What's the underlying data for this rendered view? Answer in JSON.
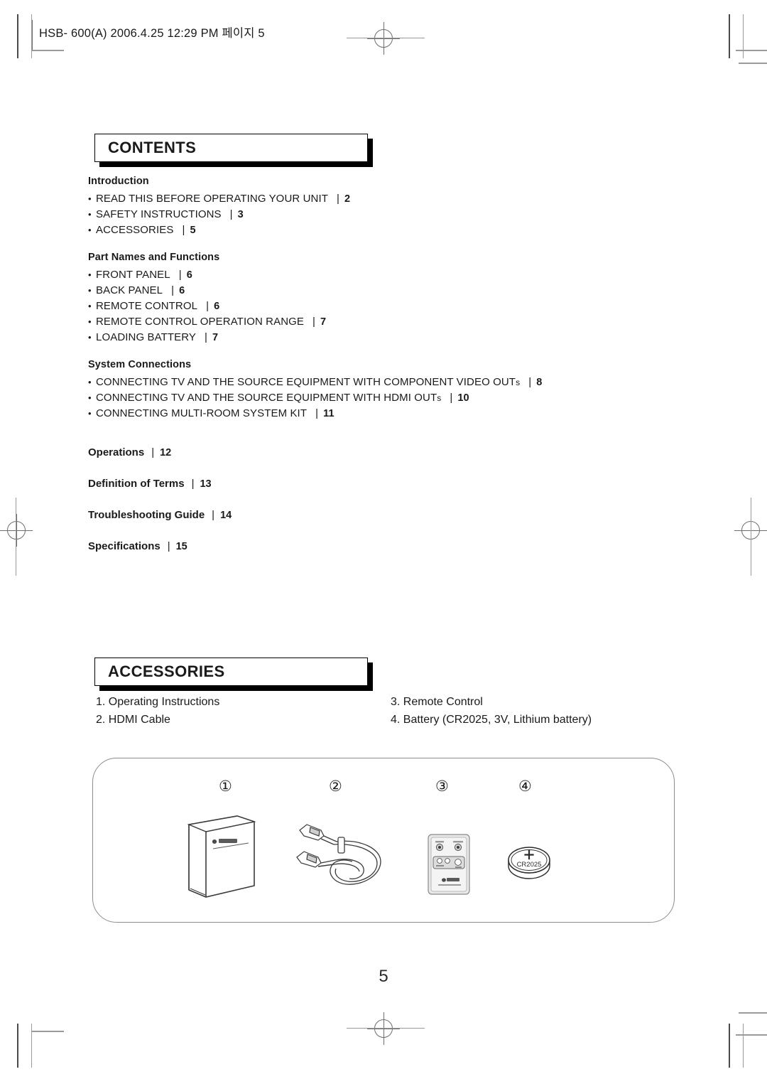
{
  "header": {
    "slug": "HSB- 600(A)  2006.4.25  12:29 PM  페이지 5"
  },
  "contents": {
    "heading": "CONTENTS",
    "groups": [
      {
        "title": "Introduction",
        "items": [
          {
            "label": "READ THIS BEFORE OPERATING YOUR UNIT",
            "suffix": "",
            "separator": "|",
            "page": "2"
          },
          {
            "label": "SAFETY INSTRUCTIONS",
            "suffix": "",
            "separator": "|",
            "page": "3"
          },
          {
            "label": "ACCESSORIES",
            "suffix": "",
            "separator": "|",
            "page": "5"
          }
        ]
      },
      {
        "title": "Part Names and Functions",
        "items": [
          {
            "label": "FRONT PANEL",
            "suffix": "",
            "separator": "|",
            "page": "6"
          },
          {
            "label": "BACK PANEL",
            "suffix": "",
            "separator": "|",
            "page": "6"
          },
          {
            "label": "REMOTE CONTROL",
            "suffix": "",
            "separator": "|",
            "page": "6"
          },
          {
            "label": "REMOTE CONTROL OPERATION RANGE",
            "suffix": "",
            "separator": "|",
            "page": "7"
          },
          {
            "label": "LOADING BATTERY",
            "suffix": "",
            "separator": "|",
            "page": "7"
          }
        ]
      },
      {
        "title": "System Connections",
        "items": [
          {
            "label": "CONNECTING TV AND THE SOURCE EQUIPMENT WITH COMPONENT VIDEO OUT",
            "suffix": "s",
            "separator": "|",
            "page": "8"
          },
          {
            "label": "CONNECTING TV AND THE SOURCE EQUIPMENT WITH HDMI OUT",
            "suffix": "s",
            "separator": "|",
            "page": "10"
          },
          {
            "label": "CONNECTING MULTI-ROOM SYSTEM KIT",
            "suffix": "",
            "separator": "|",
            "page": "11"
          }
        ]
      }
    ],
    "standalone": [
      {
        "label": "Operations",
        "separator": "|",
        "page": "12"
      },
      {
        "label": "Definition of Terms",
        "separator": "|",
        "page": "13"
      },
      {
        "label": "Troubleshooting Guide",
        "separator": "|",
        "page": "14"
      },
      {
        "label": "Specifications",
        "separator": "|",
        "page": "15"
      }
    ]
  },
  "accessories": {
    "heading": "ACCESSORIES",
    "left_column": [
      "1. Operating Instructions",
      "2. HDMI Cable"
    ],
    "right_column": [
      "3. Remote Control",
      "4. Battery (CR2025, 3V, Lithium battery)"
    ],
    "callouts": [
      "①",
      "②",
      "③",
      "④"
    ],
    "battery_label": "CR2025",
    "battery_polarity": "+"
  },
  "folio": {
    "page_number": "5"
  }
}
